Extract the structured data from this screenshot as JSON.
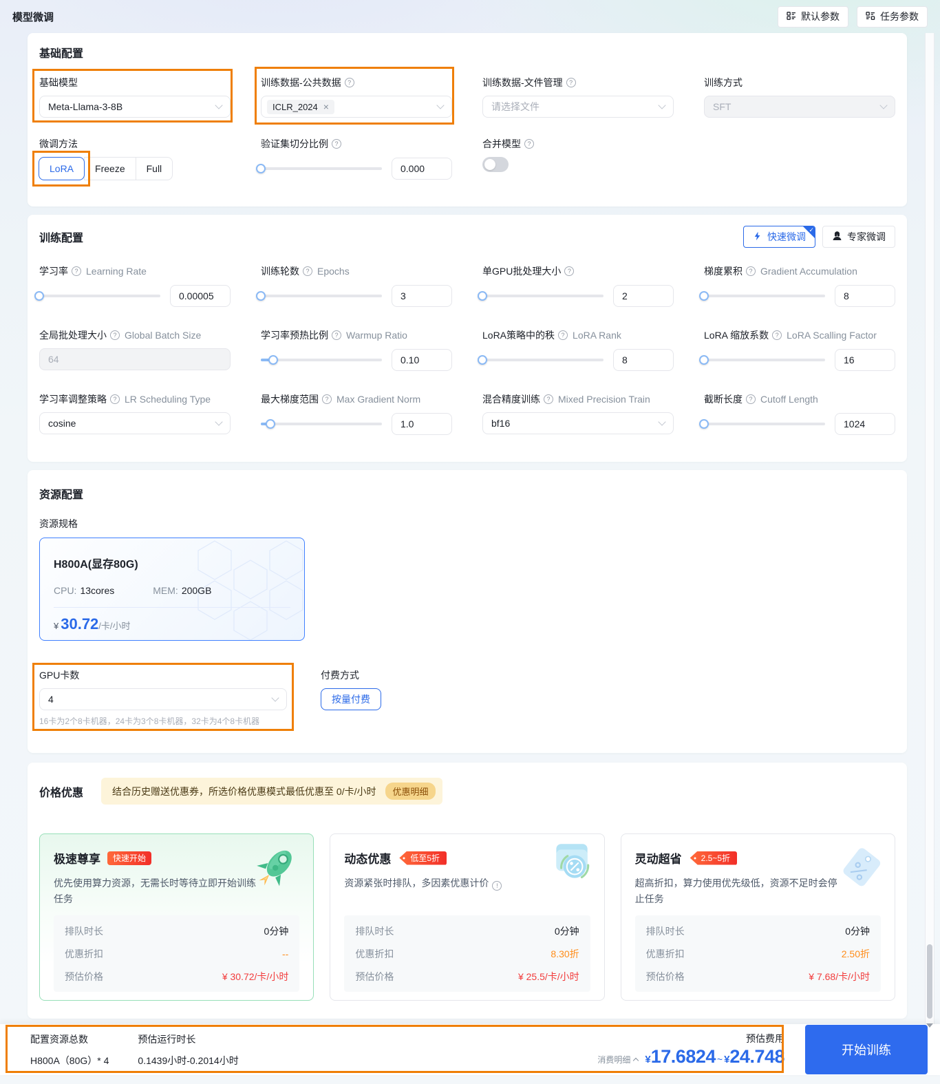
{
  "colors": {
    "accent_blue": "#2b6ae8",
    "annotation_orange": "#ef7f06",
    "price_red": "#f23c3c",
    "discount_orange": "#ff8d1a",
    "selected_green_border": "#97dfb8",
    "notice_amber_bg": "#fdf4da",
    "spec_border_blue": "#4080ff"
  },
  "page": {
    "title": "模型微调"
  },
  "header": {
    "default_params": "默认参数",
    "task_params": "任务参数"
  },
  "basic": {
    "title": "基础配置",
    "base_model": {
      "label": "基础模型",
      "value": "Meta-Llama-3-8B"
    },
    "public_data": {
      "label": "训练数据-公共数据",
      "tag": "ICLR_2024",
      "remove": "×"
    },
    "file_data": {
      "label": "训练数据-文件管理",
      "placeholder": "请选择文件"
    },
    "train_method": {
      "label": "训练方式",
      "value": "SFT"
    },
    "finetune": {
      "label": "微调方法",
      "options": [
        "LoRA",
        "Freeze",
        "Full"
      ],
      "selected": "LoRA"
    },
    "val_split": {
      "label": "验证集切分比例",
      "value": "0.000"
    },
    "merge": {
      "label": "合并模型",
      "state": "off"
    }
  },
  "training": {
    "title": "训练配置",
    "quick_btn": "快速微调",
    "expert_btn": "专家微调",
    "params": [
      {
        "zh": "学习率",
        "en": "Learning Rate",
        "value": "0.00005"
      },
      {
        "zh": "训练轮数",
        "en": "Epochs",
        "value": "3"
      },
      {
        "zh": "单GPU批处理大小",
        "en": "",
        "value": "2"
      },
      {
        "zh": "梯度累积",
        "en": "Gradient Accumulation",
        "value": "8"
      },
      {
        "zh": "全局批处理大小",
        "en": "Global Batch Size",
        "value": "64"
      },
      {
        "zh": "学习率预热比例",
        "en": "Warmup Ratio",
        "value": "0.10"
      },
      {
        "zh": "LoRA策略中的秩",
        "en": "LoRA Rank",
        "value": "8"
      },
      {
        "zh": "LoRA 缩放系数",
        "en": "LoRA Scalling Factor",
        "value": "16"
      },
      {
        "zh": "学习率调整策略",
        "en": "LR Scheduling Type",
        "value": "cosine"
      },
      {
        "zh": "最大梯度范围",
        "en": "Max Gradient Norm",
        "value": "1.0"
      },
      {
        "zh": "混合精度训练",
        "en": "Mixed Precision Train",
        "value": "bf16"
      },
      {
        "zh": "截断长度",
        "en": "Cutoff Length",
        "value": "1024"
      }
    ]
  },
  "resource": {
    "title": "资源配置",
    "spec_label": "资源规格",
    "spec": {
      "name": "H800A(显存80G)",
      "cpu_label": "CPU:",
      "cpu": "13cores",
      "mem_label": "MEM:",
      "mem": "200GB",
      "yen": "¥",
      "price": "30.72",
      "unit": "/卡/小时"
    },
    "gpu": {
      "label": "GPU卡数",
      "value": "4",
      "hint": "16卡为2个8卡机器，24卡为3个8卡机器，32卡为4个8卡机器"
    },
    "pay": {
      "label": "付费方式",
      "button": "按量付费"
    }
  },
  "pricing": {
    "title": "价格优惠",
    "notice": "结合历史赠送优惠券，所选价格优惠模式最低优惠至 0/卡/小时",
    "detail": "优惠明细",
    "row_labels": {
      "queue": "排队时长",
      "discount": "优惠折扣",
      "price": "预估价格"
    },
    "cards": [
      {
        "name": "极速尊享",
        "badge": "快速开始",
        "desc": "优先使用算力资源，无需长时等待立即开始训练任务",
        "queue": "0分钟",
        "discount": "--",
        "price": "¥ 30.72/卡/小时"
      },
      {
        "name": "动态优惠",
        "badge": "低至5折",
        "desc": "资源紧张时排队，多因素优惠计价",
        "queue": "0分钟",
        "discount": "8.30折",
        "price": "¥ 25.5/卡/小时"
      },
      {
        "name": "灵动超省",
        "badge": "2.5~5折",
        "desc": "超高折扣，算力使用优先级低，资源不足时会停止任务",
        "queue": "0分钟",
        "discount": "2.50折",
        "price": "¥ 7.68/卡/小时"
      }
    ]
  },
  "footer": {
    "resource_label": "配置资源总数",
    "resource_value": "H800A（80G）* 4",
    "duration_label": "预估运行时长",
    "duration_value": "0.1439小时-0.2014小时",
    "fee_label": "预估费用",
    "detail_label": "消费明细",
    "yen": "¥",
    "min": "17.6824",
    "tilde": "~",
    "max": "24.748",
    "start": "开始训练"
  },
  "icons": {
    "header_buttons": "grid-list-icon",
    "quick_mode": "lightning-icon",
    "expert_mode": "expert-person-icon",
    "selected_corner": "check-icon",
    "card1": "rocket-icon",
    "card2": "wallet-percent-icon",
    "card3": "price-tag-icon",
    "help": "question-circle-icon",
    "info": "info-circle-icon",
    "fee": "caret-up-icon"
  }
}
